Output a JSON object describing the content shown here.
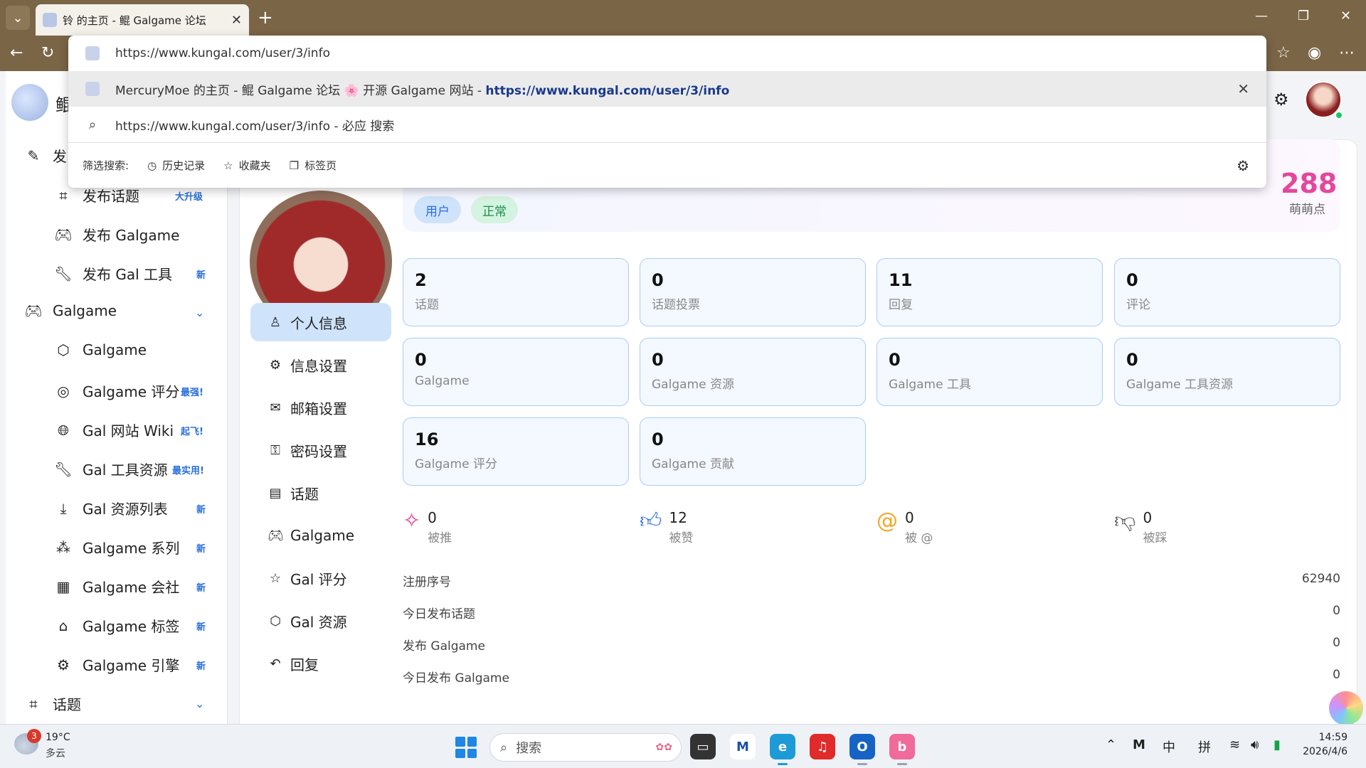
{
  "browser": {
    "tab_title": "铃 的主页 - 鲲 Galgame 论坛",
    "omnibox": {
      "input_value": "https://www.kungal.com/user/3/info",
      "suggestion_text": "MercuryMoe 的主页 - 鲲 Galgame 论坛 🌸 开源 Galgame 网站 - ",
      "suggestion_url": "https://www.kungal.com/user/3/info",
      "search_row": "https://www.kungal.com/user/3/info - 必应 搜索",
      "filter_label": "筛选搜索:",
      "filters": [
        "历史记录",
        "收藏夹",
        "标签页"
      ]
    }
  },
  "sidebar": {
    "logo_text": "鲲",
    "publish_label": "发",
    "items": [
      {
        "label": "发布话题",
        "badge": "大升级",
        "icon": "hash-icon"
      },
      {
        "label": "发布 Galgame",
        "badge": "",
        "icon": "gamepad-icon"
      },
      {
        "label": "发布 Gal 工具",
        "badge": "新",
        "icon": "wrench-icon"
      }
    ],
    "group_galgame": "Galgame",
    "galgame_items": [
      {
        "label": "Galgame",
        "badge": "",
        "icon": "cube-icon"
      },
      {
        "label": "Galgame 评分",
        "badge": "最强!",
        "icon": "at-search-icon"
      },
      {
        "label": "Gal 网站 Wiki",
        "badge": "起飞!",
        "icon": "globe-icon"
      },
      {
        "label": "Gal 工具资源",
        "badge": "最实用!",
        "icon": "wrench-icon"
      },
      {
        "label": "Gal 资源列表",
        "badge": "新",
        "icon": "download-icon"
      },
      {
        "label": "Galgame 系列",
        "badge": "新",
        "icon": "cubes-icon"
      },
      {
        "label": "Galgame 会社",
        "badge": "新",
        "icon": "building-icon"
      },
      {
        "label": "Galgame 标签",
        "badge": "新",
        "icon": "tag-icon"
      },
      {
        "label": "Galgame 引擎",
        "badge": "新",
        "icon": "engine-icon"
      }
    ],
    "group_topic": "话题"
  },
  "profile": {
    "chips": [
      "用户",
      "正常"
    ],
    "moemoe_points": "288",
    "moemoe_label": "萌萌点",
    "nav": [
      "个人信息",
      "信息设置",
      "邮箱设置",
      "密码设置",
      "话题",
      "Galgame",
      "Gal 评分",
      "Gal 资源",
      "回复"
    ],
    "stats": [
      {
        "n": "2",
        "l": "话题"
      },
      {
        "n": "0",
        "l": "话题投票"
      },
      {
        "n": "11",
        "l": "回复"
      },
      {
        "n": "0",
        "l": "评论"
      },
      {
        "n": "0",
        "l": "Galgame"
      },
      {
        "n": "0",
        "l": "Galgame 资源"
      },
      {
        "n": "0",
        "l": "Galgame 工具"
      },
      {
        "n": "0",
        "l": "Galgame 工具资源"
      },
      {
        "n": "16",
        "l": "Galgame 评分"
      },
      {
        "n": "0",
        "l": "Galgame 贡献"
      }
    ],
    "reactions": [
      {
        "n": "0",
        "l": "被推",
        "icon": "sparkle-icon",
        "color": "#e4479b"
      },
      {
        "n": "12",
        "l": "被赞",
        "icon": "thumbs-up-icon",
        "color": "#2a6fdb"
      },
      {
        "n": "0",
        "l": "被 @",
        "icon": "at-icon",
        "color": "#f5a524"
      },
      {
        "n": "0",
        "l": "被踩",
        "icon": "thumbs-down-icon",
        "color": "#555555"
      }
    ],
    "info_rows": [
      {
        "k": "注册序号",
        "v": "62940"
      },
      {
        "k": "今日发布话题",
        "v": "0"
      },
      {
        "k": "发布 Galgame",
        "v": "0"
      },
      {
        "k": "今日发布 Galgame",
        "v": "0"
      }
    ]
  },
  "taskbar": {
    "weather_badge": "3",
    "weather_temp": "19°C",
    "weather_desc": "多云",
    "search_placeholder": "搜索",
    "tray_ime_1": "中",
    "tray_ime_2": "拼",
    "time": "14:59",
    "date": "2026/4/6"
  }
}
